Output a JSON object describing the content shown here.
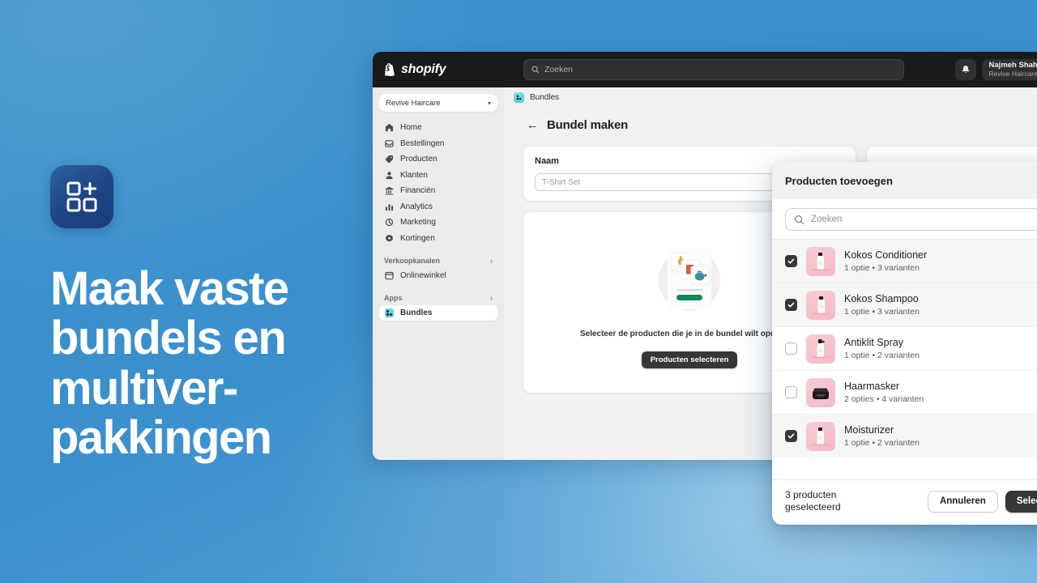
{
  "promo": {
    "app_icon": "bundles-app-icon",
    "headline": "Maak vaste\nbundels en\nmultiver-\npakkingen",
    "background_color": "#3a90ce"
  },
  "topbar": {
    "brand": "shopify",
    "search_placeholder": "Zoeken",
    "notifications_icon": "bell-icon",
    "user_name": "Najmeh Shahy",
    "user_store": "Revive Haircare"
  },
  "sidebar": {
    "store_selector": "Revive Haircare",
    "items": [
      {
        "label": "Home",
        "icon": "home-icon"
      },
      {
        "label": "Bestellingen",
        "icon": "orders-icon"
      },
      {
        "label": "Producten",
        "icon": "product-tag-icon"
      },
      {
        "label": "Klanten",
        "icon": "person-icon"
      },
      {
        "label": "Financiën",
        "icon": "bank-icon"
      },
      {
        "label": "Analytics",
        "icon": "bar-chart-icon"
      },
      {
        "label": "Marketing",
        "icon": "megaphone-icon"
      },
      {
        "label": "Kortingen",
        "icon": "discount-icon"
      }
    ],
    "sections": [
      {
        "label": "Verkoopkanalen",
        "items": [
          {
            "label": "Onlinewinkel",
            "icon": "online-store-icon"
          }
        ]
      },
      {
        "label": "Apps",
        "items": [
          {
            "label": "Bundles",
            "icon": "bundles-icon",
            "active": true
          }
        ]
      }
    ]
  },
  "breadcrumb": {
    "app_icon": "bundles-app-icon",
    "label": "Bundles",
    "pin_icon": "pin-icon"
  },
  "page": {
    "back_icon": "back-arrow-icon",
    "title": "Bundel maken"
  },
  "form": {
    "name_label": "Naam",
    "name_value": "",
    "name_placeholder": "T-Shirt Set"
  },
  "empty_state": {
    "illustration": "store-products-illustration",
    "text": "Selecteer de producten die je in de bundel wilt opnemen.",
    "button_label": "Producten selecteren"
  },
  "modal": {
    "title": "Producten toevoegen",
    "search_placeholder": "Zoeken",
    "search_icon": "search-icon",
    "products": [
      {
        "name": "Kokos Conditioner",
        "meta": "1 optie • 3 varianten",
        "checked": true,
        "thumb": "bottle-pump-white"
      },
      {
        "name": "Kokos Shampoo",
        "meta": "1 optie • 3 varianten",
        "checked": true,
        "thumb": "bottle-pump-white"
      },
      {
        "name": "Antiklit Spray",
        "meta": "1 optie • 2 varianten",
        "checked": false,
        "thumb": "bottle-spray-white"
      },
      {
        "name": "Haarmasker",
        "meta": "2 opties • 4 varianten",
        "checked": false,
        "thumb": "jar-black"
      },
      {
        "name": "Moisturizer",
        "meta": "1 optie • 2 varianten",
        "checked": true,
        "thumb": "bottle-pump-white"
      }
    ],
    "selected_count_text": "3 producten\ngeselecteerd",
    "cancel_label": "Annuleren",
    "confirm_label": "Selecteren"
  }
}
